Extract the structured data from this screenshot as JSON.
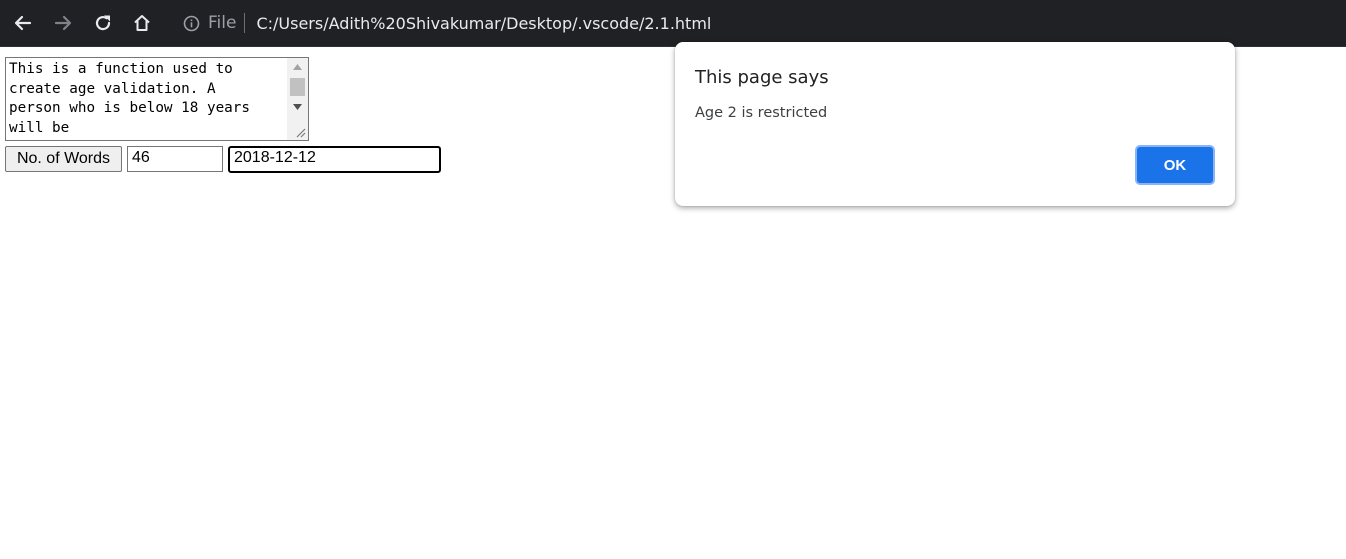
{
  "browser": {
    "scheme_label": "File",
    "url": "C:/Users/Adith%20Shivakumar/Desktop/.vscode/2.1.html",
    "icons": [
      "back-arrow-icon",
      "forward-arrow-icon",
      "reload-icon",
      "home-icon",
      "info-icon"
    ]
  },
  "page": {
    "textarea_text": "This is a function used to\ncreate age validation. A\nperson who is below 18 years\nwill be",
    "words_button_label": "No. of Words",
    "word_count_value": "46",
    "date_value": "2018-12-12"
  },
  "dialog": {
    "title": "This page says",
    "message": "Age 2 is restricted",
    "ok_label": "OK",
    "accent_color": "#1a73e8"
  }
}
